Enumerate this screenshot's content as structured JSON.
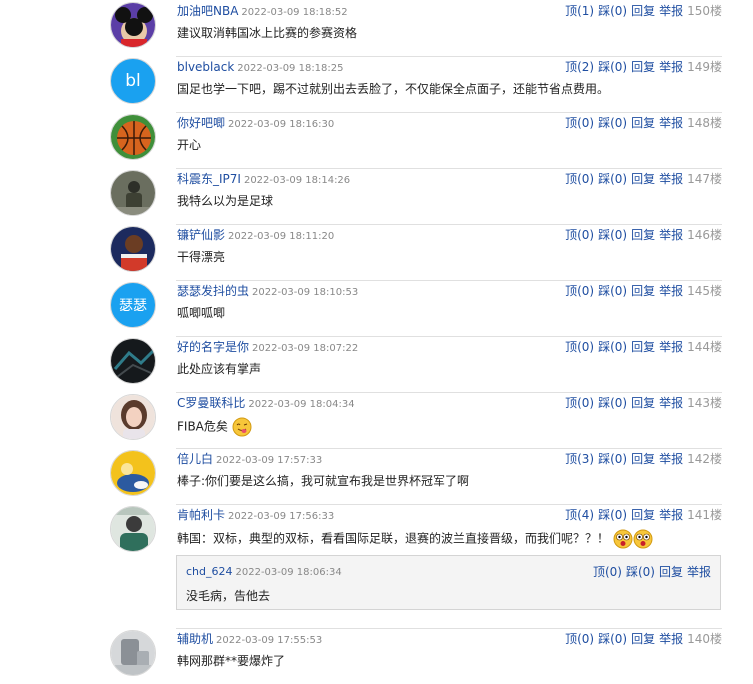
{
  "comments": [
    {
      "user": "加油吧NBA",
      "time": "2022-03-09 18:18:52",
      "text": "建议取消韩国冰上比赛的参赛资格",
      "up": "顶(1)",
      "down": "踩(0)",
      "reply": "回复",
      "report": "举报",
      "floor": "150楼",
      "avatar": "mickey-avatar"
    },
    {
      "user": "blveblack",
      "time": "2022-03-09 18:18:25",
      "text": "国足也学一下吧，踢不过就别出去丢脸了，不仅能保全点面子，还能节省点费用。",
      "up": "顶(2)",
      "down": "踩(0)",
      "reply": "回复",
      "report": "举报",
      "floor": "149楼",
      "avatar": "letter-avatar",
      "avatar_text": "bl"
    },
    {
      "user": "你好吧唧",
      "time": "2022-03-09 18:16:30",
      "text": "开心",
      "up": "顶(0)",
      "down": "踩(0)",
      "reply": "回复",
      "report": "举报",
      "floor": "148楼",
      "avatar": "basketball-avatar"
    },
    {
      "user": "科震东_IP7I",
      "time": "2022-03-09 18:14:26",
      "text": "我特么以为是足球",
      "up": "顶(0)",
      "down": "踩(0)",
      "reply": "回复",
      "report": "举报",
      "floor": "147楼",
      "avatar": "photo-avatar"
    },
    {
      "user": "镰铲仙影",
      "time": "2022-03-09 18:11:20",
      "text": "干得漂亮",
      "up": "顶(0)",
      "down": "踩(0)",
      "reply": "回复",
      "report": "举报",
      "floor": "146楼",
      "avatar": "player-avatar"
    },
    {
      "user": "瑟瑟发抖的虫",
      "time": "2022-03-09 18:10:53",
      "text": "呱唧呱唧",
      "up": "顶(0)",
      "down": "踩(0)",
      "reply": "回复",
      "report": "举报",
      "floor": "145楼",
      "avatar": "letter-avatar",
      "avatar_text": "瑟瑟"
    },
    {
      "user": "好的名字是你",
      "time": "2022-03-09 18:07:22",
      "text": "此处应该有掌声",
      "up": "顶(0)",
      "down": "踩(0)",
      "reply": "回复",
      "report": "举报",
      "floor": "144楼",
      "avatar": "dark-avatar"
    },
    {
      "user": "C罗曼联科比",
      "time": "2022-03-09 18:04:34",
      "text": "FIBA危矣",
      "up": "顶(0)",
      "down": "踩(0)",
      "reply": "回复",
      "report": "举报",
      "floor": "143楼",
      "avatar": "girl-avatar",
      "emoji_count": 1
    },
    {
      "user": "倍儿白",
      "time": "2022-03-09 17:57:33",
      "text": "棒子:你们要是这么搞，我可就宣布我是世界杯冠军了啊",
      "up": "顶(3)",
      "down": "踩(0)",
      "reply": "回复",
      "report": "举报",
      "floor": "142楼",
      "avatar": "yellow-avatar"
    },
    {
      "user": "肯帕利卡",
      "time": "2022-03-09 17:56:33",
      "text": "韩国：双标，典型的双标，看看国际足联，退赛的波兰直接晋级，而我们呢？？！",
      "up": "顶(4)",
      "down": "踩(0)",
      "reply": "回复",
      "report": "举报",
      "floor": "141楼",
      "avatar": "green-avatar",
      "emoji_count": 2
    },
    {
      "user": "辅助机",
      "time": "2022-03-09 17:55:53",
      "text": "韩网那群**要爆炸了",
      "up": "顶(0)",
      "down": "踩(0)",
      "reply": "回复",
      "report": "举报",
      "floor": "140楼",
      "avatar": "gray-avatar"
    }
  ],
  "nested_reply": {
    "user": "chd_624",
    "time": "2022-03-09 18:06:34",
    "text": "没毛病，告他去",
    "up": "顶(0)",
    "down": "踩(0)",
    "reply": "回复",
    "report": "举报"
  },
  "colors": {
    "link": "#1f4ea1",
    "letter_avatar": "#1aa1f0",
    "time": "#888888"
  }
}
